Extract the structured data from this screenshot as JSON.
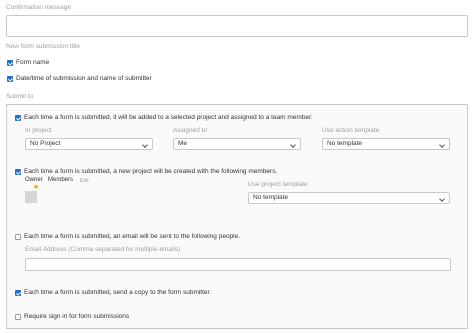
{
  "confirmation": {
    "label": "Confirmation message",
    "value": ""
  },
  "new_title": {
    "label": "New form submission title",
    "form_name": "Form name",
    "datetime": "Date/time of submission and name of submitter"
  },
  "submit_to": {
    "label": "Submit to",
    "opt1": {
      "text": "Each time a form is submitted, it will be added to a selected project and assigned to a team member.",
      "in_project_label": "In project",
      "in_project_value": "No Project",
      "assigned_label": "Assigned to",
      "assigned_value": "Me",
      "template_label": "Use action template",
      "template_value": "No template"
    },
    "opt2": {
      "text": "Each time a form is submitted, a new project will be created with the following members.",
      "owner": "Owner",
      "members": "Members",
      "edit": "Edit",
      "template_label": "Use project template",
      "template_value": "No template"
    },
    "opt3": {
      "text": "Each time a form is submitted, an email will be sent to the following people.",
      "email_label": "Email Address (Comma separated for multiple emails)",
      "email_value": ""
    },
    "opt4": {
      "text": "Each time a form is submitted, send a copy to the form submitter."
    },
    "opt5": {
      "text": "Require sign in for form submissions"
    }
  },
  "colors": {
    "accent": "#1f6fd1",
    "star": "#f39c12"
  }
}
